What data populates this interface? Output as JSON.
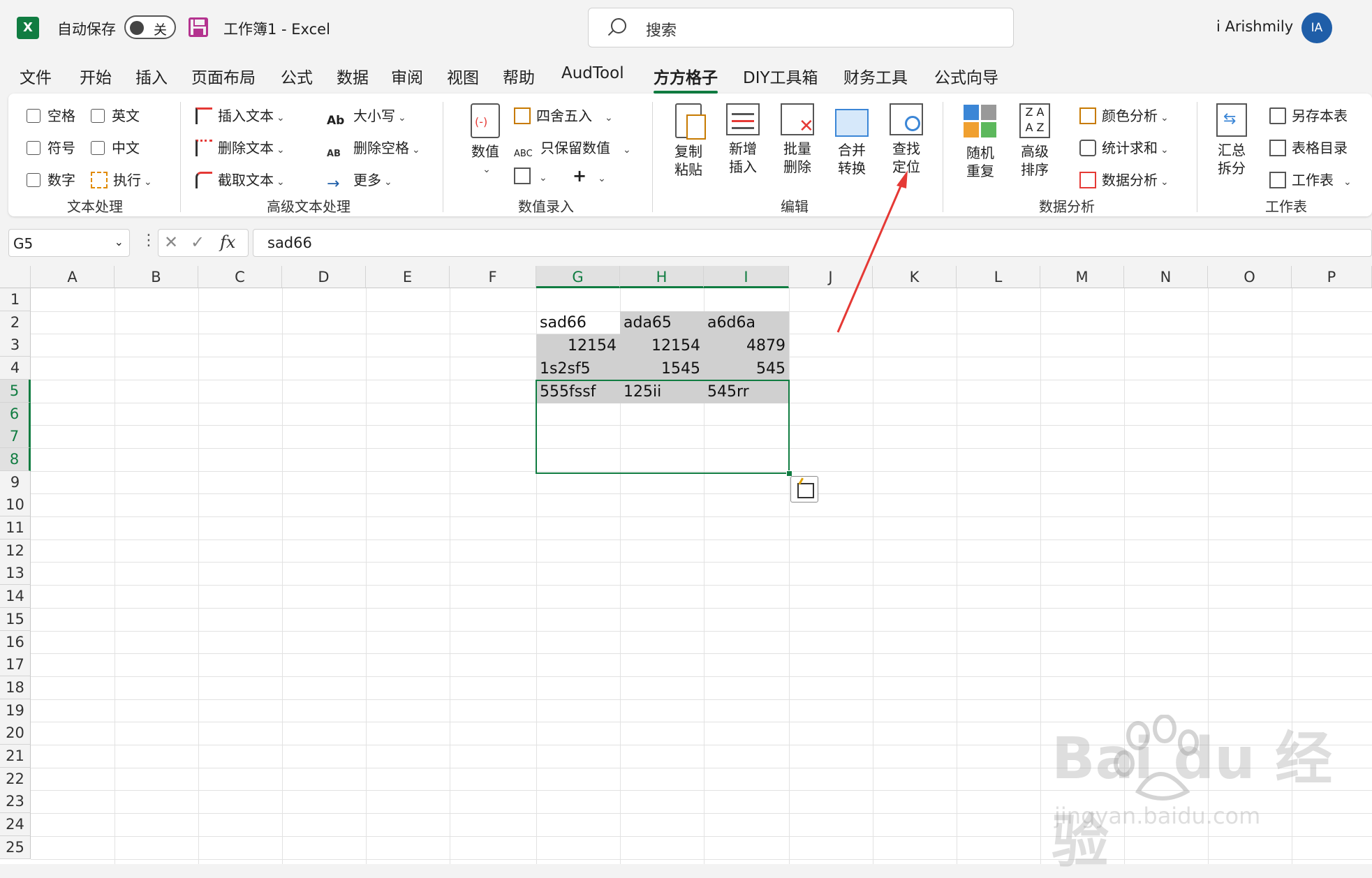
{
  "titlebar": {
    "autosave_label": "自动保存",
    "toggle_state": "关",
    "doc_title": "工作簿1  -  Excel",
    "search_placeholder": "搜索",
    "user_name": "i Arishmily",
    "avatar_initials": "IA"
  },
  "menu": [
    "文件",
    "开始",
    "插入",
    "页面布局",
    "公式",
    "数据",
    "审阅",
    "视图",
    "帮助",
    "AudTool",
    "方方格子",
    "DIY工具箱",
    "财务工具",
    "公式向导"
  ],
  "menu_active": "方方格子",
  "ribbon": {
    "text_group": {
      "label": "文本处理",
      "items": [
        "空格",
        "英文",
        "符号",
        "中文",
        "数字"
      ],
      "execute": "执行"
    },
    "adv_text_group": {
      "label": "高级文本处理",
      "insert": "插入文本",
      "delete": "删除文本",
      "cut": "截取文本",
      "case": "大小写",
      "del_space": "删除空格",
      "more": "更多"
    },
    "numeric_group": {
      "label": "数值录入",
      "value": "数值",
      "round": "四舍五入",
      "keep_num": "只保留数值",
      "plus": "+"
    },
    "edit_group": {
      "label": "编辑",
      "copy_paste": "复制粘贴",
      "new_insert": "新增插入",
      "batch_delete": "批量删除",
      "merge_convert": "合并转换",
      "find_locate": "查找定位"
    },
    "analysis_group": {
      "label": "数据分析",
      "random_dup": "随机重复",
      "adv_sort": "高级排序",
      "color_analysis": "颜色分析",
      "stats_sum": "统计求和",
      "data_analysis": "数据分析"
    },
    "worksheet_group": {
      "label": "工作表",
      "summary_split": "汇总拆分",
      "save_as": "另存本表",
      "table_index": "表格目录",
      "worksheet": "工作表"
    }
  },
  "formula_bar": {
    "name_box": "G5",
    "fx": "fx",
    "value": "sad66"
  },
  "columns": [
    "A",
    "B",
    "C",
    "D",
    "E",
    "F",
    "G",
    "H",
    "I",
    "J",
    "K",
    "L",
    "M",
    "N",
    "O",
    "P"
  ],
  "selected_columns": [
    "G",
    "H",
    "I"
  ],
  "rows": [
    "1",
    "2",
    "3",
    "4",
    "5",
    "6",
    "7",
    "8",
    "9",
    "10",
    "11",
    "12",
    "13",
    "14",
    "15",
    "16",
    "17",
    "18",
    "19",
    "20",
    "21",
    "22",
    "23",
    "24",
    "25"
  ],
  "selected_rows": [
    "5",
    "6",
    "7",
    "8"
  ],
  "cells": {
    "G5": "sad66",
    "H5": "ada65",
    "I5": "a6d6a",
    "G6": "12154",
    "H6": "12154",
    "I6": "4879",
    "G7": "1s2sf5",
    "H7": "1545",
    "I7": "545",
    "G8": "555fssf",
    "H8": "125ii",
    "I8": "545rr"
  },
  "watermark": {
    "main": "Bai  du 经验",
    "sub": "jingyan.baidu.com"
  },
  "colors": {
    "accent": "#107c41",
    "arrow": "#e53935"
  }
}
